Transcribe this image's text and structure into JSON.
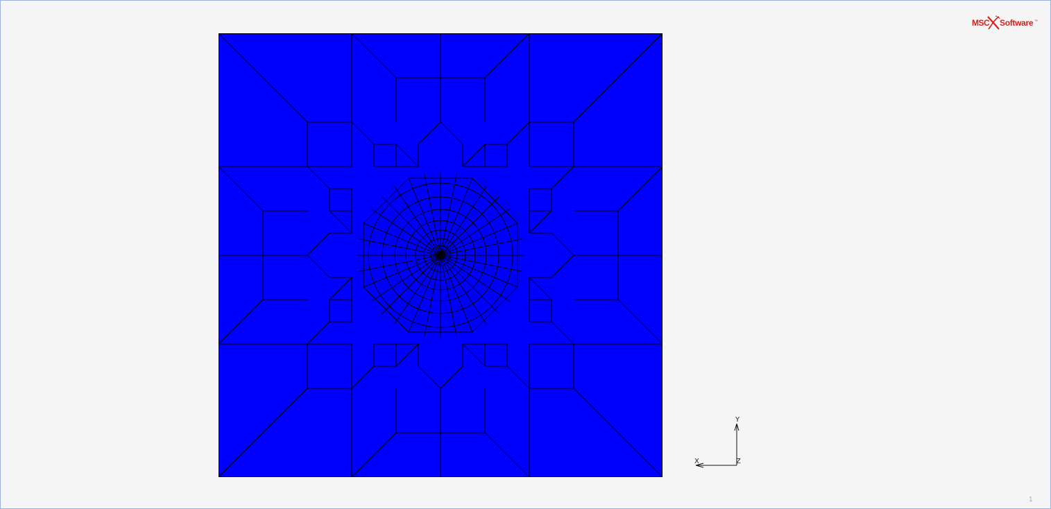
{
  "viewport": {
    "background": "#f5f5f5",
    "border_color": "#9bb3d8"
  },
  "logo": {
    "brand_left": "MSC",
    "brand_right": "Software",
    "trademark": "™",
    "color": "#d32020"
  },
  "model": {
    "fill_color": "#0000ff",
    "edge_color": "#000000"
  },
  "triad": {
    "x_label": "X",
    "y_label": "Y",
    "z_label": "Z"
  },
  "frame_number": "1"
}
